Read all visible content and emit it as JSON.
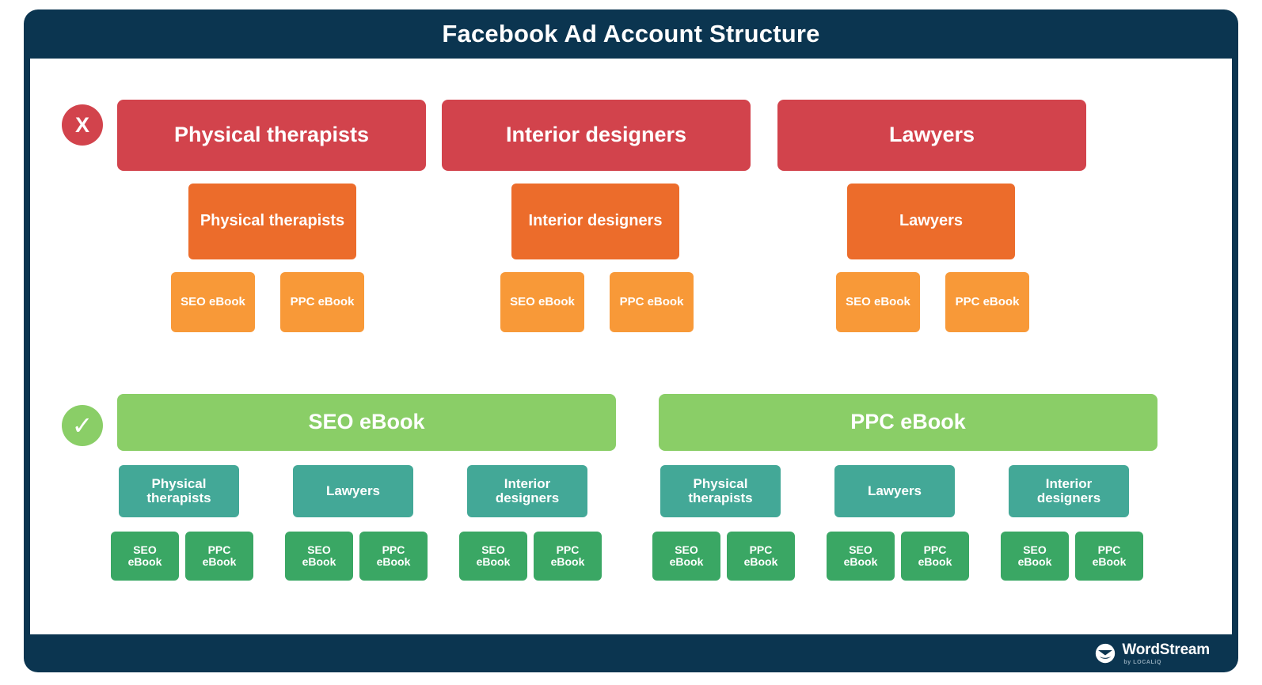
{
  "header": {
    "title": "Facebook Ad Account Structure"
  },
  "badges": {
    "bad": {
      "glyph": "X",
      "name": "incorrect"
    },
    "good": {
      "glyph": "✓",
      "name": "correct"
    }
  },
  "colors": {
    "frame_navy": "#0b3550",
    "campaign_bad": "#d2434c",
    "adset_bad": "#ec6c2b",
    "ad_bad": "#f89938",
    "campaign_good": "#8ace67",
    "adset_good": "#43a897",
    "ad_good": "#3aa764",
    "panel_bg": "#ffffff"
  },
  "bad_section": {
    "columns": [
      {
        "campaign": "Physical therapists",
        "adset": "Physical therapists",
        "ads": [
          "SEO eBook",
          "PPC eBook"
        ]
      },
      {
        "campaign": "Interior designers",
        "adset": "Interior designers",
        "ads": [
          "SEO eBook",
          "PPC eBook"
        ]
      },
      {
        "campaign": "Lawyers",
        "adset": "Lawyers",
        "ads": [
          "SEO eBook",
          "PPC eBook"
        ]
      }
    ]
  },
  "good_section": {
    "columns": [
      {
        "campaign": "SEO eBook",
        "adsets": [
          {
            "label": "Physical therapists",
            "ads": [
              "SEO eBook",
              "PPC eBook"
            ]
          },
          {
            "label": "Lawyers",
            "ads": [
              "SEO eBook",
              "PPC eBook"
            ]
          },
          {
            "label": "Interior designers",
            "ads": [
              "SEO eBook",
              "PPC eBook"
            ]
          }
        ]
      },
      {
        "campaign": "PPC eBook",
        "adsets": [
          {
            "label": "Physical therapists",
            "ads": [
              "SEO eBook",
              "PPC eBook"
            ]
          },
          {
            "label": "Lawyers",
            "ads": [
              "SEO eBook",
              "PPC eBook"
            ]
          },
          {
            "label": "Interior designers",
            "ads": [
              "SEO eBook",
              "PPC eBook"
            ]
          }
        ]
      }
    ]
  },
  "footer": {
    "logo_name": "WordStream",
    "logo_sub": "by LOCALiQ"
  }
}
